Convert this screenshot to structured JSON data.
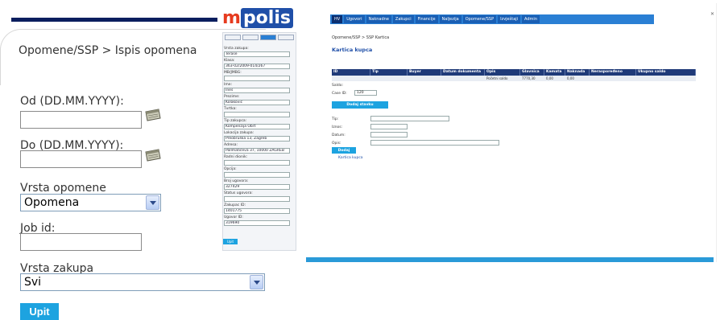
{
  "left_form": {
    "breadcrumb": "Opomene/SSP > Ispis opomena",
    "od_label": "Od (DD.MM.YYYY):",
    "od_value": "",
    "do_label": "Do (DD.MM.YYYY):",
    "do_value": "",
    "vrsta_opomene_label": "Vrsta opomene",
    "vrsta_opomene_value": "Opomena",
    "job_id_label": "Job id:",
    "job_id_value": "",
    "vrsta_zakupa_label": "Vrsta zakupa",
    "vrsta_zakupa_value": "Svi",
    "submit_label": "Upit"
  },
  "background_app": {
    "logo_m": "m",
    "logo_rest": "polis",
    "nav": [
      "HV",
      "Ugovori",
      "Naknadne",
      "Zakupci",
      "Financije",
      "Naljezija",
      "Opomene/SSP",
      "Izvještaji",
      "Admin"
    ],
    "sidebar": {
      "tabs": [
        "",
        "",
        "",
        ""
      ],
      "fields": [
        {
          "label": "Vrsta zakupa:",
          "value": "Terase"
        },
        {
          "label": "Klasa:",
          "value": "363-02/2009-014/267"
        },
        {
          "label": "MB/JMBG:",
          "value": ""
        },
        {
          "label": "Ime:",
          "value": "Ines"
        },
        {
          "label": "Prezime:",
          "value": "Kolaković"
        },
        {
          "label": "Tvrtka:",
          "value": ""
        },
        {
          "label": "Tip zakupca:",
          "value": "Kompenzija Obrt"
        },
        {
          "label": "Lokacija zakupa:",
          "value": "Preobruška 13, Zagreb"
        },
        {
          "label": "Adresa:",
          "value": "Pallmatičeva 37, 10000 ZAGREB"
        },
        {
          "label": "Radni dionik:",
          "value": ""
        },
        {
          "label": "Opcija:",
          "value": ""
        },
        {
          "label": "Broj ugovora:",
          "value": "327429"
        },
        {
          "label": "Status ugovora:",
          "value": ""
        },
        {
          "label": "Zakupac ID:",
          "value": "1401775"
        },
        {
          "label": "Ugovor ID:",
          "value": "319690"
        }
      ],
      "submit": "Upit"
    },
    "main": {
      "breadcrumb": "Opomene/SSP > SSP Kartica",
      "title": "Kartica kupca",
      "table_headers": [
        "ID",
        "Tip",
        "Buyer",
        "Datum dokumenta",
        "Opis",
        "Glavnica",
        "Kamata",
        "Naknada",
        "Neraspoređeno",
        "Ukupno saldo"
      ],
      "table_row": [
        "",
        "",
        "",
        "",
        "Početni saldo",
        "7770,30",
        "0,00",
        "0,00",
        "",
        ""
      ],
      "saldo_label": "Saldo:",
      "case_label": "Case ID:",
      "case_value": "120",
      "add_button": "Dodaj stavku",
      "form_labels": [
        "Tip:",
        "Iznos:",
        "Datum:",
        "Opis:"
      ],
      "save_button": "Dodaj",
      "link": "Kartica kupca"
    }
  }
}
